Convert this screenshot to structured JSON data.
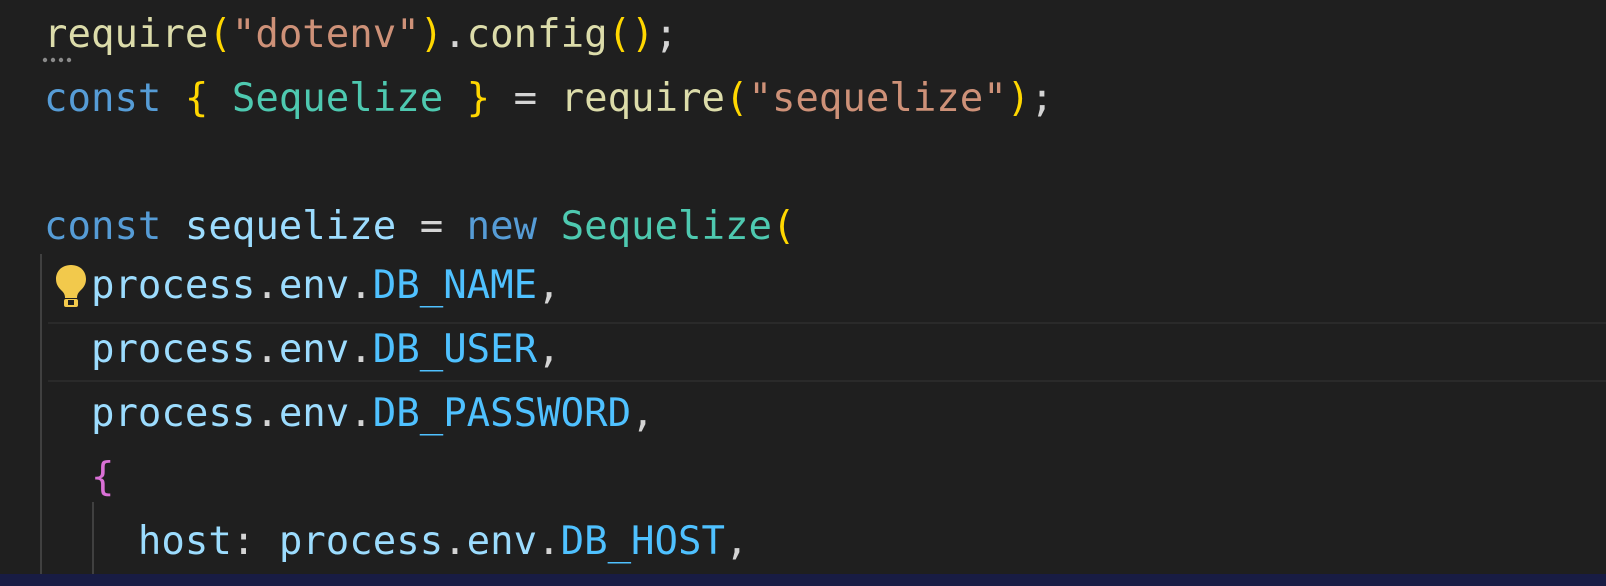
{
  "editor": {
    "lines": [
      {
        "name": "code-line-1",
        "tokens": [
          {
            "t": "require",
            "c": "fn"
          },
          {
            "t": "(",
            "c": "br1"
          },
          {
            "t": "\"dotenv\"",
            "c": "str"
          },
          {
            "t": ")",
            "c": "br1"
          },
          {
            "t": ".",
            "c": "plain"
          },
          {
            "t": "config",
            "c": "fn"
          },
          {
            "t": "()",
            "c": "br1"
          },
          {
            "t": ";",
            "c": "plain"
          }
        ]
      },
      {
        "name": "code-line-2",
        "tokens": [
          {
            "t": "const",
            "c": "kw"
          },
          {
            "t": " ",
            "c": "plain"
          },
          {
            "t": "{",
            "c": "br1"
          },
          {
            "t": " ",
            "c": "plain"
          },
          {
            "t": "Sequelize",
            "c": "cls"
          },
          {
            "t": " ",
            "c": "plain"
          },
          {
            "t": "}",
            "c": "br1"
          },
          {
            "t": " = ",
            "c": "plain"
          },
          {
            "t": "require",
            "c": "fn"
          },
          {
            "t": "(",
            "c": "br1"
          },
          {
            "t": "\"sequelize\"",
            "c": "str"
          },
          {
            "t": ")",
            "c": "br1"
          },
          {
            "t": ";",
            "c": "plain"
          }
        ]
      },
      {
        "name": "code-line-3",
        "tokens": []
      },
      {
        "name": "code-line-4",
        "tokens": [
          {
            "t": "const",
            "c": "kw"
          },
          {
            "t": " ",
            "c": "plain"
          },
          {
            "t": "sequelize",
            "c": "var"
          },
          {
            "t": " = ",
            "c": "plain"
          },
          {
            "t": "new",
            "c": "kw"
          },
          {
            "t": " ",
            "c": "plain"
          },
          {
            "t": "Sequelize",
            "c": "cls"
          },
          {
            "t": "(",
            "c": "br1"
          }
        ]
      },
      {
        "name": "code-line-5",
        "tokens": [
          {
            "t": "  ",
            "c": "plain"
          },
          {
            "t": "process",
            "c": "var"
          },
          {
            "t": ".",
            "c": "plain"
          },
          {
            "t": "env",
            "c": "var"
          },
          {
            "t": ".",
            "c": "plain"
          },
          {
            "t": "DB_NAME",
            "c": "const"
          },
          {
            "t": ",",
            "c": "plain"
          }
        ]
      },
      {
        "name": "code-line-6",
        "tokens": [
          {
            "t": "  ",
            "c": "plain"
          },
          {
            "t": "process",
            "c": "var"
          },
          {
            "t": ".",
            "c": "plain"
          },
          {
            "t": "env",
            "c": "var"
          },
          {
            "t": ".",
            "c": "plain"
          },
          {
            "t": "DB_USER",
            "c": "const"
          },
          {
            "t": ",",
            "c": "plain"
          }
        ]
      },
      {
        "name": "code-line-7",
        "tokens": [
          {
            "t": "  ",
            "c": "plain"
          },
          {
            "t": "process",
            "c": "var"
          },
          {
            "t": ".",
            "c": "plain"
          },
          {
            "t": "env",
            "c": "var"
          },
          {
            "t": ".",
            "c": "plain"
          },
          {
            "t": "DB_PASSWORD",
            "c": "const"
          },
          {
            "t": ",",
            "c": "plain"
          }
        ]
      },
      {
        "name": "code-line-8",
        "tokens": [
          {
            "t": "  ",
            "c": "plain"
          },
          {
            "t": "{",
            "c": "br2"
          }
        ]
      },
      {
        "name": "code-line-9",
        "tokens": [
          {
            "t": "    ",
            "c": "plain"
          },
          {
            "t": "host",
            "c": "var"
          },
          {
            "t": ": ",
            "c": "plain"
          },
          {
            "t": "process",
            "c": "var"
          },
          {
            "t": ".",
            "c": "plain"
          },
          {
            "t": "env",
            "c": "var"
          },
          {
            "t": ".",
            "c": "plain"
          },
          {
            "t": "DB_HOST",
            "c": "const"
          },
          {
            "t": ",",
            "c": "plain"
          }
        ]
      }
    ]
  },
  "icons": {
    "lightbulb": "lightbulb-icon",
    "hint_dots": "hint-dots-icon"
  },
  "colors": {
    "background": "#1f1f1f",
    "keyword": "#569cd6",
    "function": "#dcdcaa",
    "string": "#ce9178",
    "class": "#4ec9b0",
    "variable": "#9cdcfe",
    "constant": "#4fc1ff",
    "bracket_level1": "#ffd700",
    "bracket_level2": "#da70d6",
    "lightbulb": "#f2c94c",
    "status_bar": "#181c44"
  }
}
